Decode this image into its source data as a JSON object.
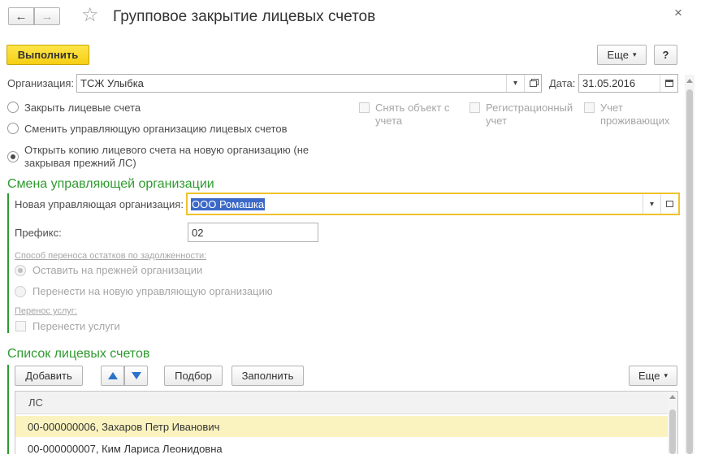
{
  "window": {
    "title": "Групповое закрытие лицевых счетов",
    "close_glyph": "×",
    "nav_back_glyph": "←",
    "nav_forward_glyph": "→",
    "star_glyph": "☆"
  },
  "toolbar": {
    "execute_label": "Выполнить",
    "more_label": "Еще",
    "more_arrow": "▾",
    "help_label": "?"
  },
  "org_row": {
    "org_label": "Организация:",
    "org_value": "ТСЖ Улыбка",
    "date_label": "Дата:",
    "date_value": "31.05.2016"
  },
  "mode_options": [
    {
      "label": "Закрыть лицевые счета",
      "checked": false
    },
    {
      "label": "Сменить управляющую организацию лицевых счетов",
      "checked": false
    },
    {
      "label_line1": "Открыть копию лицевого счета на новую организацию (не",
      "label_line2": "закрывая прежний ЛС)",
      "checked": true
    }
  ],
  "checkboxes": [
    {
      "line1": "Снять объект с",
      "line2": "учета"
    },
    {
      "line1": "Регистрационный",
      "line2": "учет"
    },
    {
      "line1": "Учет",
      "line2": "проживающих"
    }
  ],
  "change_section": {
    "title": "Смена управляющей организации",
    "new_org_label": "Новая управляющая организация:",
    "new_org_value": "ООО Ромашка",
    "prefix_label": "Префикс:",
    "prefix_value": "02",
    "debt_caption": "Способ переноса остатков по задолженности:",
    "debt_options": [
      {
        "label": "Оставить на прежней организации",
        "checked": true
      },
      {
        "label": "Перенести на новую управляющую организацию",
        "checked": false
      }
    ],
    "services_caption": "Перенос услуг:",
    "services_check_label": "Перенести услуги"
  },
  "accounts_section": {
    "title": "Список лицевых счетов",
    "add_label": "Добавить",
    "up_glyph": "🡅",
    "down_glyph": "🡇",
    "pick_label": "Подбор",
    "fill_label": "Заполнить",
    "more_label": "Еще",
    "column_header": "ЛС",
    "rows": [
      "00-000000006, Захаров Петр Иванович",
      "00-000000007, Ким Лариса Леонидовна"
    ]
  },
  "colors": {
    "accent_green": "#2f9a2f",
    "primary_yellow": "#f5cf14",
    "selected_row": "#faf3bf",
    "focus_border": "#f0c22c"
  }
}
